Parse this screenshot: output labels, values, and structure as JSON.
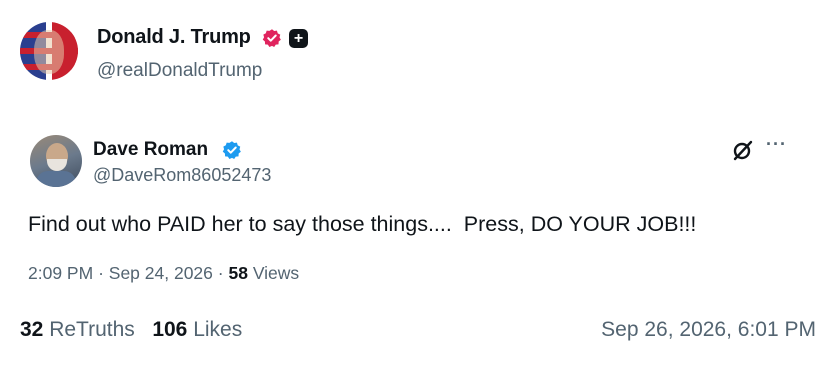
{
  "post": {
    "author_name": "Donald J. Trump",
    "author_handle": "@realDonaldTrump",
    "verified_icon": "verified-badge-icon",
    "verified_color": "#e0245e",
    "plus_badge": "+",
    "retruths_count": "32",
    "retruths_label": "ReTruths",
    "likes_count": "106",
    "likes_label": "Likes",
    "date": "Sep 26, 2026, 6:01 PM"
  },
  "quoted": {
    "author_name": "Dave Roman",
    "author_handle": "@DaveRom86052473",
    "verified_color": "#1d9bf0",
    "text": "Find out who PAID her to say those things....  Press, DO YOUR JOB!!!",
    "time": "2:09 PM",
    "date": "Sep 24, 2026",
    "views_count": "58",
    "views_label": "Views",
    "separator": "·",
    "more_label": "···"
  }
}
